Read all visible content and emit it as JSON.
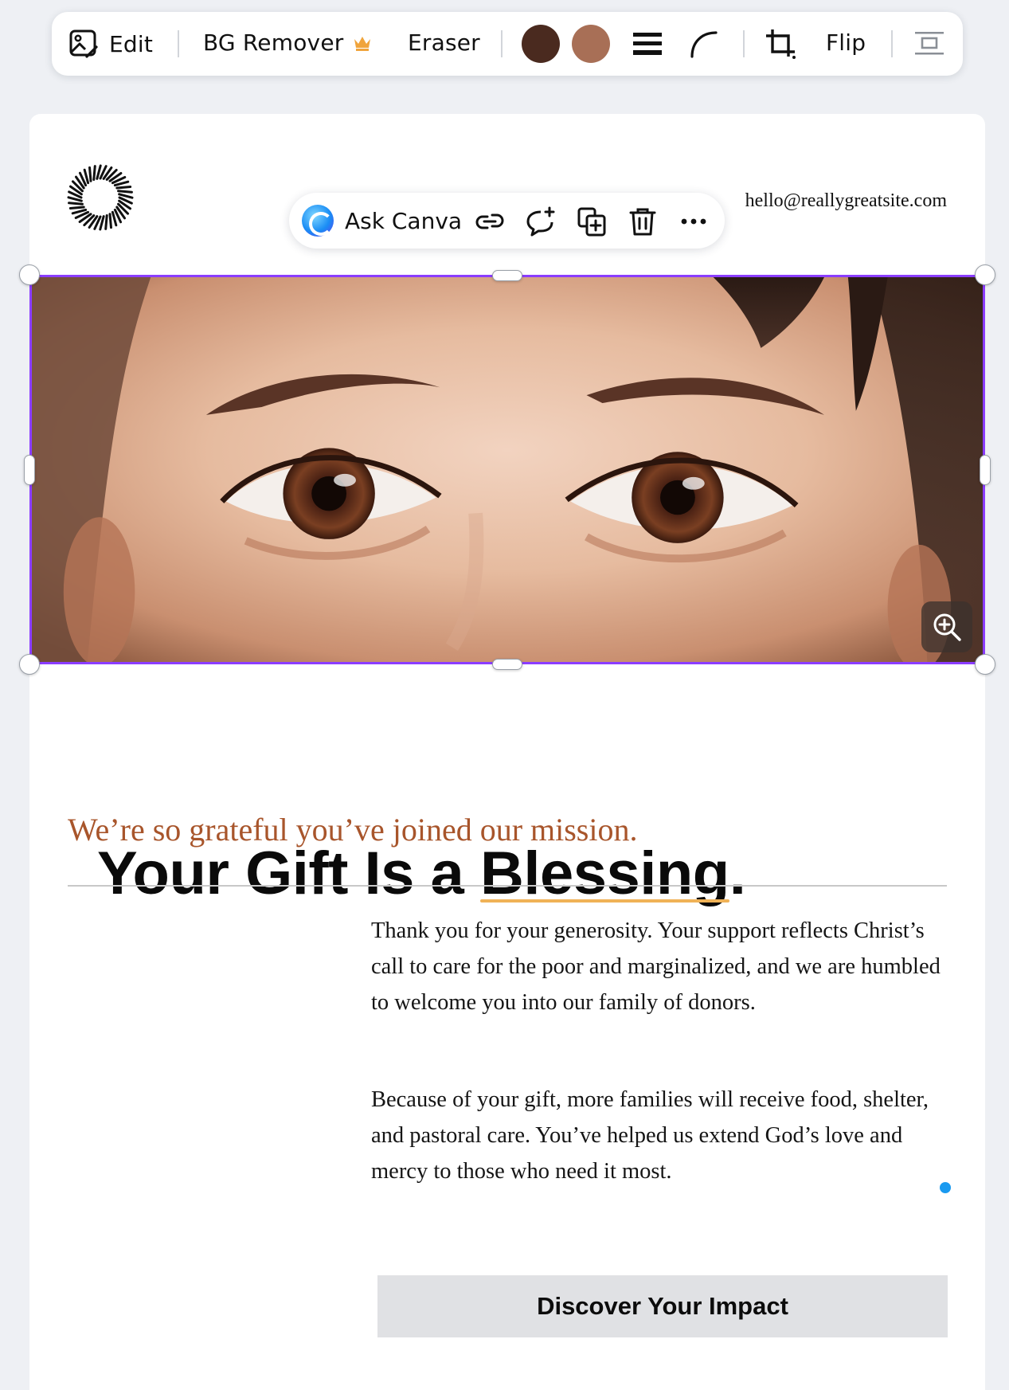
{
  "toolbar": {
    "edit_label": "Edit",
    "bg_remover_label": "BG Remover",
    "eraser_label": "Eraser",
    "flip_label": "Flip",
    "swatches": [
      "#4a2a1f",
      "#a86f56"
    ],
    "premium_icon": "crown-icon"
  },
  "context_toolbar": {
    "ask_label": "Ask Canva",
    "icons": [
      "link-icon",
      "comment-add-icon",
      "duplicate-icon",
      "trash-icon",
      "more-icon"
    ]
  },
  "page": {
    "contact_email": "hello@reallygreatsite.com",
    "headline_prefix": "Your Gift Is a ",
    "headline_accent": "Blessing",
    "headline_suffix": ".",
    "subheadline": "We’re so grateful you’ve joined our mission.",
    "paragraph_1": "Thank you for your generosity. Your support reflects Christ’s call to care for the poor and marginalized, and we are humbled to welcome you into our family of donors.",
    "paragraph_2": "Because of your gift, more families will receive food, shelter, and pastoral care. You’ve helped us extend God’s love and mercy to those who need it most.",
    "cta_label": "Discover Your Impact",
    "accent_underline_color": "#f0b257",
    "subheadline_color": "#a8552b",
    "selection_color": "#8b3dff"
  }
}
